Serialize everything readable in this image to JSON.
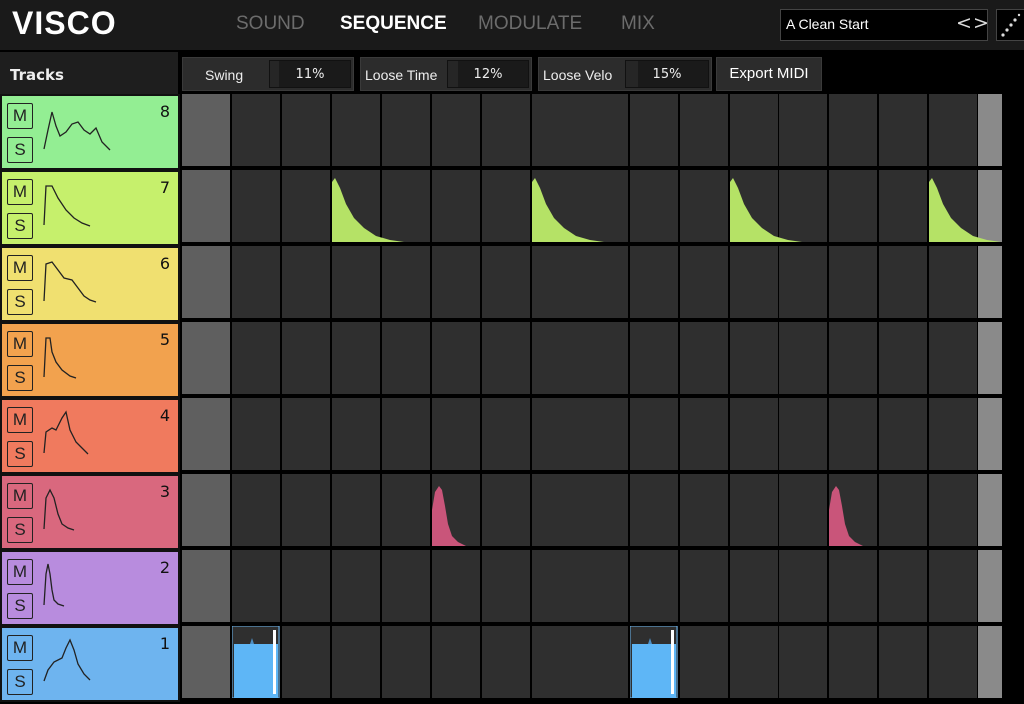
{
  "app": {
    "logo": "VISCO"
  },
  "nav": {
    "tabs": [
      {
        "label": "SOUND",
        "active": false
      },
      {
        "label": "SEQUENCE",
        "active": true
      },
      {
        "label": "MODULATE",
        "active": false
      },
      {
        "label": "MIX",
        "active": false
      }
    ]
  },
  "preset": {
    "name": "A Clean Start",
    "prev": "<",
    "next": ">",
    "menu_icon": "dots-icon"
  },
  "tracks_header": "Tracks",
  "params": {
    "swing": {
      "label": "Swing",
      "value": "11%",
      "fraction": 0.11
    },
    "loose_time": {
      "label": "Loose Time",
      "value": "12%",
      "fraction": 0.12
    },
    "loose_velo": {
      "label": "Loose Velo",
      "value": "15%",
      "fraction": 0.15
    }
  },
  "export_label": "Export MIDI",
  "tracks": [
    {
      "num": "8",
      "mute": "M",
      "solo": "S",
      "color": "#93ee93",
      "steps": []
    },
    {
      "num": "7",
      "mute": "M",
      "solo": "S",
      "color": "#c6f06c",
      "steps": [
        3,
        7,
        11,
        15
      ]
    },
    {
      "num": "6",
      "mute": "M",
      "solo": "S",
      "color": "#f0e070",
      "steps": []
    },
    {
      "num": "5",
      "mute": "M",
      "solo": "S",
      "color": "#f2a24e",
      "steps": []
    },
    {
      "num": "4",
      "mute": "M",
      "solo": "S",
      "color": "#f07a5e",
      "steps": []
    },
    {
      "num": "3",
      "mute": "M",
      "solo": "S",
      "color": "#d9687e",
      "steps": [
        5,
        13
      ]
    },
    {
      "num": "2",
      "mute": "M",
      "solo": "S",
      "color": "#b88cde",
      "steps": []
    },
    {
      "num": "1",
      "mute": "M",
      "solo": "S",
      "color": "#6eb4ef",
      "steps": [
        1,
        9
      ]
    }
  ],
  "colors": {
    "pulse_green": "#b5e266",
    "pulse_pink": "#c9557a",
    "pulse_blue": "#5eb6f6"
  }
}
